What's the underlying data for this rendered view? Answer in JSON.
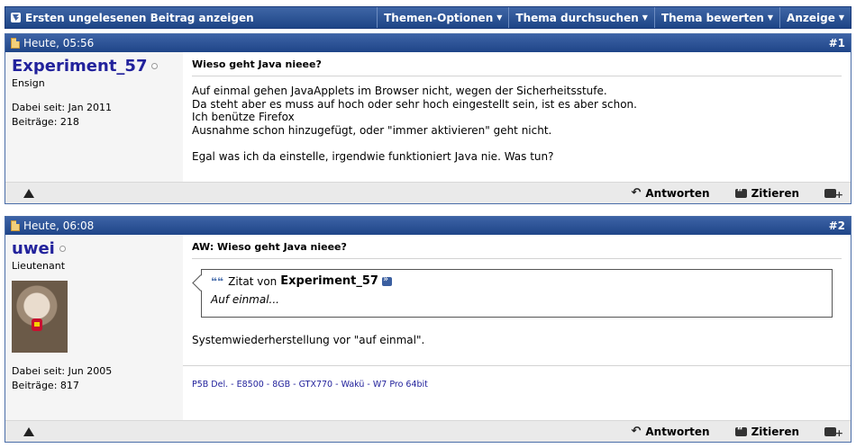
{
  "toolbar": {
    "first_unread": "Ersten ungelesenen Beitrag anzeigen",
    "menus": [
      "Themen-Optionen",
      "Thema durchsuchen",
      "Thema bewerten",
      "Anzeige"
    ]
  },
  "posts": [
    {
      "date": "Heute, 05:56",
      "number": "#1",
      "username": "Experiment_57",
      "rank": "Ensign",
      "joined": "Dabei seit: Jan 2011",
      "posts_count": "Beiträge: 218",
      "title": "Wieso geht Java nieee?",
      "lines": [
        "Auf einmal gehen JavaApplets im Browser nicht, wegen der Sicherheitsstufe.",
        "Da steht aber es muss auf hoch oder sehr hoch eingestellt sein, ist es aber schon.",
        "Ich benütze Firefox",
        "Ausnahme schon hinzugefügt, oder \"immer aktivieren\" geht nicht.",
        "",
        "Egal was ich da einstelle, irgendwie funktioniert Java nie. Was tun?"
      ]
    },
    {
      "date": "Heute, 06:08",
      "number": "#2",
      "username": "uwei",
      "rank": "Lieutenant",
      "joined": "Dabei seit: Jun 2005",
      "posts_count": "Beiträge: 817",
      "title": "AW: Wieso geht Java nieee?",
      "quote": {
        "prefix": "Zitat von",
        "author": "Experiment_57",
        "text": "Auf einmal..."
      },
      "message": "Systemwiederherstellung vor \"auf einmal\".",
      "signature": "P5B Del. - E8500 - 8GB - GTX770 - Wakü - W7 Pro 64bit"
    }
  ],
  "actions": {
    "reply": "Antworten",
    "quote": "Zitieren"
  },
  "icons": [
    "down-arrow-icon",
    "caret-down-icon",
    "post-doc-icon",
    "offline-status-icon",
    "warning-icon",
    "reply-icon",
    "quote-icon",
    "multiquote-icon",
    "view-post-icon"
  ]
}
